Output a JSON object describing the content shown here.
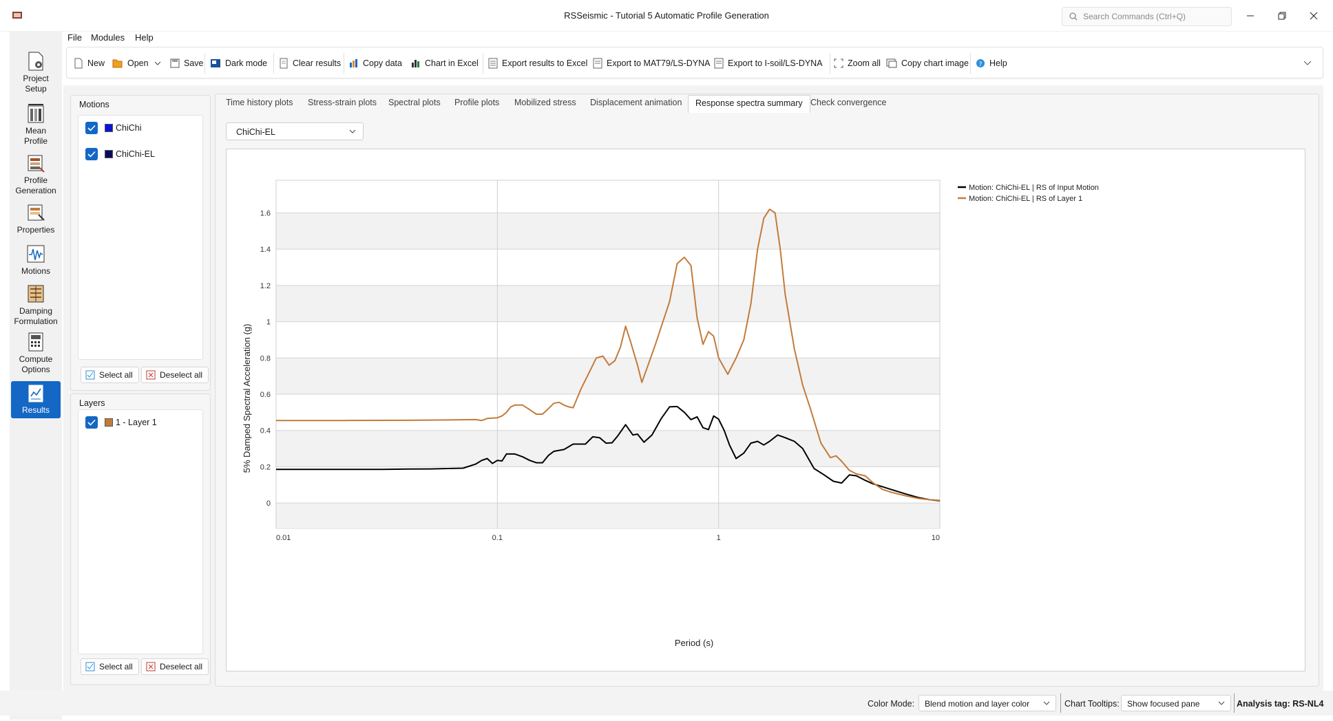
{
  "window": {
    "title": "RSSeismic - Tutorial 5 Automatic Profile Generation",
    "search_placeholder": "Search Commands (Ctrl+Q)"
  },
  "menu": [
    "File",
    "Modules",
    "Help"
  ],
  "nav": [
    {
      "label1": "Project",
      "label2": "Setup"
    },
    {
      "label1": "Mean",
      "label2": "Profile"
    },
    {
      "label1": "Profile",
      "label2": "Generation"
    },
    {
      "label1": "Properties",
      "label2": ""
    },
    {
      "label1": "Motions",
      "label2": ""
    },
    {
      "label1": "Damping",
      "label2": "Formulation"
    },
    {
      "label1": "Compute",
      "label2": "Options"
    },
    {
      "label1": "Results",
      "label2": ""
    }
  ],
  "toolbar": {
    "new": "New",
    "open": "Open",
    "save": "Save",
    "dark_mode": "Dark mode",
    "clear_results": "Clear results",
    "copy_data": "Copy data",
    "chart_in_excel": "Chart in Excel",
    "export_excel": "Export results to Excel",
    "export_mat79": "Export to MAT79/LS-DYNA",
    "export_isoil": "Export to I-soil/LS-DYNA",
    "zoom_all": "Zoom all",
    "copy_chart_image": "Copy chart image",
    "help": "Help"
  },
  "motions_panel": {
    "title": "Motions",
    "items": [
      {
        "label": "ChiChi",
        "color": "#0a14d8"
      },
      {
        "label": "ChiChi-EL",
        "color": "#0b0b5e"
      }
    ],
    "select_all": "Select all",
    "deselect_all": "Deselect all"
  },
  "layers_panel": {
    "title": "Layers",
    "items": [
      {
        "label": "1 - Layer 1",
        "color": "#c47a3a"
      }
    ],
    "select_all": "Select all",
    "deselect_all": "Deselect all"
  },
  "tabs": [
    "Time history plots",
    "Stress-strain plots",
    "Spectral plots",
    "Profile plots",
    "Mobilized stress",
    "Displacement animation",
    "Response spectra summary",
    "Check convergence"
  ],
  "active_tab": "Response spectra summary",
  "motion_select": {
    "value": "ChiChi-EL"
  },
  "chart_data": {
    "type": "line",
    "xlabel": "Period (s)",
    "ylabel": "5% Damped Spectral Acceleration (g)",
    "x_scale": "log",
    "xlim": [
      0.01,
      10
    ],
    "ylim": [
      -0.14,
      1.78
    ],
    "x_ticks": [
      "0.01",
      "0.1",
      "1",
      "10"
    ],
    "y_ticks": [
      "0",
      "0.2",
      "0.4",
      "0.6",
      "0.8",
      "1",
      "1.2",
      "1.4",
      "1.6"
    ],
    "grid": true,
    "legend_position": "right",
    "series": [
      {
        "name": "Motion: ChiChi-EL | RS of Input Motion",
        "color": "#000000",
        "points": [
          [
            0.01,
            0.185
          ],
          [
            0.02,
            0.185
          ],
          [
            0.03,
            0.185
          ],
          [
            0.04,
            0.187
          ],
          [
            0.05,
            0.188
          ],
          [
            0.06,
            0.19
          ],
          [
            0.07,
            0.192
          ],
          [
            0.08,
            0.215
          ],
          [
            0.085,
            0.235
          ],
          [
            0.09,
            0.245
          ],
          [
            0.095,
            0.218
          ],
          [
            0.1,
            0.235
          ],
          [
            0.105,
            0.232
          ],
          [
            0.11,
            0.27
          ],
          [
            0.12,
            0.27
          ],
          [
            0.13,
            0.255
          ],
          [
            0.14,
            0.235
          ],
          [
            0.15,
            0.222
          ],
          [
            0.16,
            0.222
          ],
          [
            0.17,
            0.262
          ],
          [
            0.18,
            0.285
          ],
          [
            0.2,
            0.295
          ],
          [
            0.22,
            0.325
          ],
          [
            0.25,
            0.325
          ],
          [
            0.27,
            0.365
          ],
          [
            0.29,
            0.36
          ],
          [
            0.31,
            0.33
          ],
          [
            0.33,
            0.332
          ],
          [
            0.35,
            0.37
          ],
          [
            0.38,
            0.432
          ],
          [
            0.41,
            0.375
          ],
          [
            0.43,
            0.38
          ],
          [
            0.46,
            0.335
          ],
          [
            0.5,
            0.375
          ],
          [
            0.55,
            0.465
          ],
          [
            0.6,
            0.53
          ],
          [
            0.65,
            0.532
          ],
          [
            0.7,
            0.5
          ],
          [
            0.75,
            0.46
          ],
          [
            0.8,
            0.475
          ],
          [
            0.85,
            0.415
          ],
          [
            0.9,
            0.405
          ],
          [
            0.95,
            0.48
          ],
          [
            1.0,
            0.462
          ],
          [
            1.06,
            0.4
          ],
          [
            1.12,
            0.32
          ],
          [
            1.2,
            0.245
          ],
          [
            1.3,
            0.275
          ],
          [
            1.4,
            0.33
          ],
          [
            1.5,
            0.34
          ],
          [
            1.6,
            0.32
          ],
          [
            1.7,
            0.34
          ],
          [
            1.85,
            0.375
          ],
          [
            2.0,
            0.36
          ],
          [
            2.2,
            0.34
          ],
          [
            2.4,
            0.3
          ],
          [
            2.7,
            0.19
          ],
          [
            3.0,
            0.155
          ],
          [
            3.3,
            0.12
          ],
          [
            3.6,
            0.11
          ],
          [
            3.9,
            0.155
          ],
          [
            4.2,
            0.15
          ],
          [
            4.6,
            0.125
          ],
          [
            5.0,
            0.105
          ],
          [
            5.5,
            0.09
          ],
          [
            6.0,
            0.075
          ],
          [
            7.0,
            0.05
          ],
          [
            8.0,
            0.03
          ],
          [
            9.0,
            0.018
          ],
          [
            10,
            0.012
          ]
        ]
      },
      {
        "name": "Motion: ChiChi-EL | RS of Layer 1",
        "color": "#c47a3a",
        "points": [
          [
            0.01,
            0.455
          ],
          [
            0.02,
            0.455
          ],
          [
            0.04,
            0.456
          ],
          [
            0.06,
            0.458
          ],
          [
            0.08,
            0.46
          ],
          [
            0.085,
            0.455
          ],
          [
            0.09,
            0.466
          ],
          [
            0.1,
            0.47
          ],
          [
            0.105,
            0.48
          ],
          [
            0.11,
            0.5
          ],
          [
            0.115,
            0.53
          ],
          [
            0.12,
            0.54
          ],
          [
            0.13,
            0.54
          ],
          [
            0.14,
            0.515
          ],
          [
            0.15,
            0.49
          ],
          [
            0.16,
            0.49
          ],
          [
            0.17,
            0.52
          ],
          [
            0.18,
            0.55
          ],
          [
            0.19,
            0.555
          ],
          [
            0.2,
            0.54
          ],
          [
            0.21,
            0.53
          ],
          [
            0.22,
            0.525
          ],
          [
            0.24,
            0.635
          ],
          [
            0.26,
            0.72
          ],
          [
            0.28,
            0.8
          ],
          [
            0.3,
            0.81
          ],
          [
            0.32,
            0.76
          ],
          [
            0.34,
            0.785
          ],
          [
            0.36,
            0.86
          ],
          [
            0.38,
            0.975
          ],
          [
            0.4,
            0.89
          ],
          [
            0.43,
            0.76
          ],
          [
            0.45,
            0.665
          ],
          [
            0.48,
            0.76
          ],
          [
            0.52,
            0.88
          ],
          [
            0.56,
            1.0
          ],
          [
            0.6,
            1.11
          ],
          [
            0.65,
            1.32
          ],
          [
            0.7,
            1.355
          ],
          [
            0.75,
            1.31
          ],
          [
            0.8,
            1.02
          ],
          [
            0.85,
            0.875
          ],
          [
            0.9,
            0.945
          ],
          [
            0.95,
            0.92
          ],
          [
            1.0,
            0.8
          ],
          [
            1.1,
            0.71
          ],
          [
            1.2,
            0.8
          ],
          [
            1.3,
            0.9
          ],
          [
            1.4,
            1.1
          ],
          [
            1.5,
            1.4
          ],
          [
            1.6,
            1.57
          ],
          [
            1.7,
            1.62
          ],
          [
            1.8,
            1.6
          ],
          [
            1.9,
            1.4
          ],
          [
            2.0,
            1.15
          ],
          [
            2.2,
            0.85
          ],
          [
            2.4,
            0.65
          ],
          [
            2.6,
            0.52
          ],
          [
            2.9,
            0.33
          ],
          [
            3.2,
            0.25
          ],
          [
            3.4,
            0.26
          ],
          [
            3.6,
            0.23
          ],
          [
            3.9,
            0.18
          ],
          [
            4.2,
            0.16
          ],
          [
            4.6,
            0.15
          ],
          [
            5.0,
            0.11
          ],
          [
            5.5,
            0.075
          ],
          [
            6.0,
            0.06
          ],
          [
            7.0,
            0.04
          ],
          [
            8.0,
            0.025
          ],
          [
            9.0,
            0.018
          ],
          [
            10,
            0.015
          ]
        ]
      }
    ]
  },
  "statusbar": {
    "color_mode_label": "Color Mode:",
    "color_mode_value": "Blend motion and layer color",
    "tooltips_label": "Chart Tooltips:",
    "tooltips_value": "Show focused pane",
    "analysis_tag": "Analysis tag: RS-NL4"
  }
}
